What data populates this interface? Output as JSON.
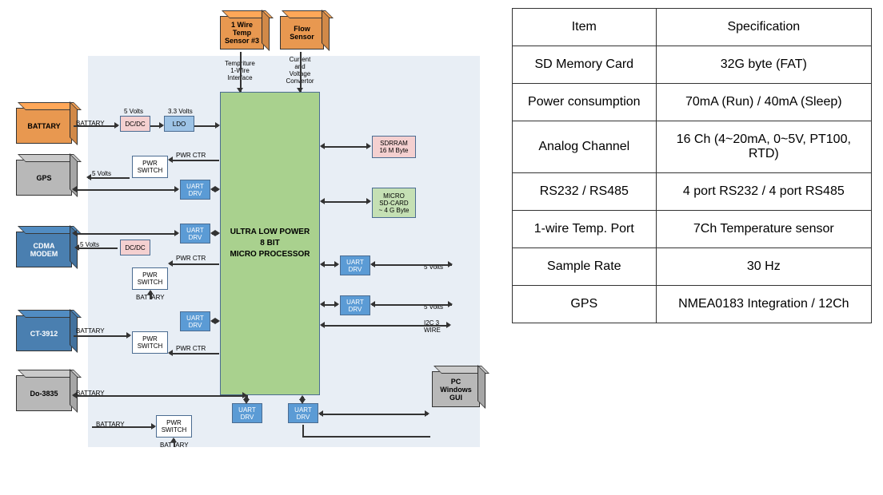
{
  "diagram": {
    "sensors": {
      "temp_sensor": "1 Wire\nTemp\nSensor #3",
      "flow_sensor": "Flow Sensor"
    },
    "top_labels": {
      "temp_interface": "Tempriture\n1-Wire\nInterface",
      "voltage_conv": "Current\nand\nVoltage\nConvertor"
    },
    "left_cubes": {
      "battery": "BATTARY",
      "gps": "GPS",
      "cdma": "CDMA\nMODEM",
      "ct3912": "CT-3912",
      "do3835": "Do-3835"
    },
    "right_cube": {
      "pc_gui": "PC\nWindows\nGUI"
    },
    "right_blocks": {
      "sdram": "SDRRAM\n16 M Byte",
      "sdcard": "MICRO\nSD-CARD\n~ 4 G Byte"
    },
    "blocks": {
      "dcdc": "DC/DC",
      "ldo": "LDO",
      "pwr_switch": "PWR\nSWITCH",
      "uart_drv": "UART\nDRV"
    },
    "processor": "ULTRA LOW POWER\n8 BIT\nMICRO PROCESSOR",
    "labels": {
      "battery": "BATTARY",
      "v5": "5 Volts",
      "v33": "3.3 Volts",
      "pwr_ctr": "PWR CTR",
      "i2c": "I2C 3\nWIRE"
    }
  },
  "table": {
    "head": {
      "item": "Item",
      "spec": "Specification"
    },
    "rows": [
      {
        "item": "SD Memory Card",
        "spec": "32G byte (FAT)"
      },
      {
        "item": "Power consumption",
        "spec": "70mA (Run)  / 40mA (Sleep)"
      },
      {
        "item": "Analog Channel",
        "spec": "16 Ch (4~20mA, 0~5V, PT100, RTD)"
      },
      {
        "item": "RS232 / RS485",
        "spec": "4 port RS232 / 4 port RS485"
      },
      {
        "item": "1-wire Temp. Port",
        "spec": "7Ch Temperature sensor"
      },
      {
        "item": "Sample Rate",
        "spec": "30 Hz"
      },
      {
        "item": "GPS",
        "spec": "NMEA0183 Integration / 12Ch"
      }
    ]
  }
}
